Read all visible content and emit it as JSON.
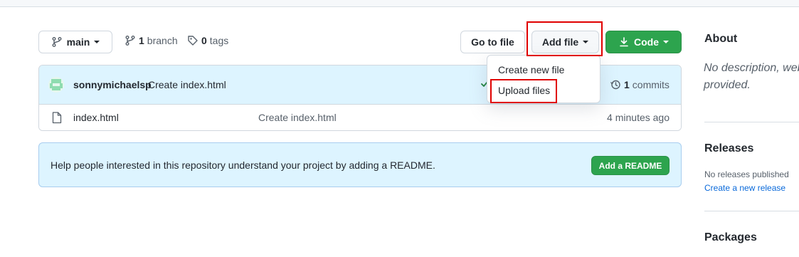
{
  "toolbar": {
    "branch_label": "main",
    "branches_count": "1",
    "branches_label": "branch",
    "tags_count": "0",
    "tags_label": "tags",
    "go_to_file_label": "Go to file",
    "add_file_label": "Add file",
    "code_label": "Code"
  },
  "add_file_menu": {
    "items": [
      {
        "label": "Create new file"
      },
      {
        "label": "Upload files"
      }
    ]
  },
  "latest_commit": {
    "author": "sonnymichaelsp",
    "message": "Create index.html",
    "commits_count": "1",
    "commits_label": "commits"
  },
  "files": [
    {
      "name": "index.html",
      "commit_message": "Create index.html",
      "age": "4 minutes ago"
    }
  ],
  "readme_banner": {
    "text": "Help people interested in this repository understand your project by adding a README.",
    "button_label": "Add a README"
  },
  "sidebar": {
    "about_heading": "About",
    "about_text_line1": "No description, web",
    "about_text_line2": "provided.",
    "releases_heading": "Releases",
    "releases_text": "No releases published",
    "releases_link": "Create a new release",
    "packages_heading": "Packages"
  },
  "colors": {
    "accent_green": "#2da44e",
    "highlight_red": "#e00000",
    "link_blue": "#0969da",
    "commit_bg": "#ddf4ff"
  }
}
